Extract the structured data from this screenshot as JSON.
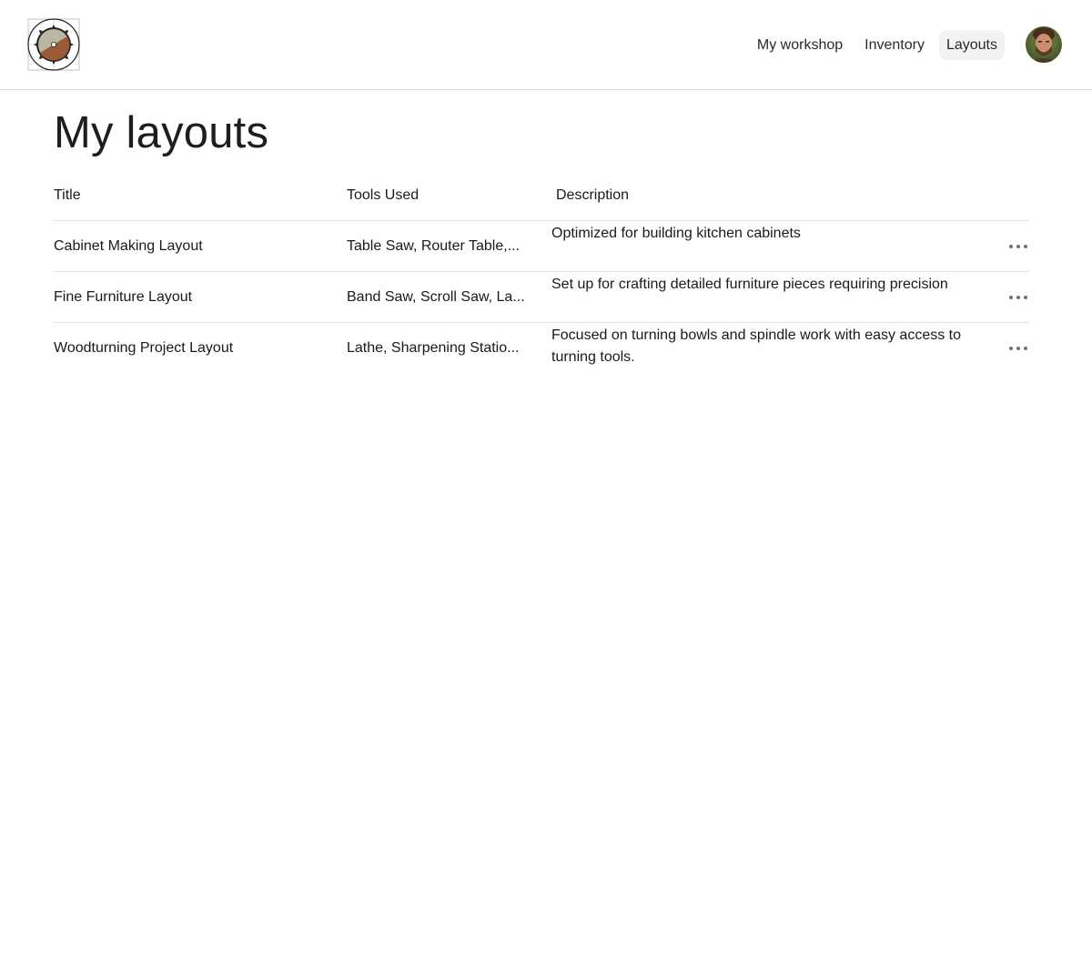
{
  "header": {
    "logo_icon": "circular-saw-blade-logo",
    "nav": [
      {
        "label": "My workshop",
        "active": false
      },
      {
        "label": "Inventory",
        "active": false
      },
      {
        "label": "Layouts",
        "active": true
      }
    ],
    "avatar_icon": "user-avatar"
  },
  "page": {
    "title": "My layouts"
  },
  "table": {
    "columns": [
      "Title",
      "Tools Used",
      "Description"
    ],
    "rows": [
      {
        "title": "Cabinet Making Layout",
        "tools": "Table Saw, Router Table,...",
        "description": "Optimized for building kitchen cabinets",
        "action_icon": "more-horizontal-icon"
      },
      {
        "title": "Fine Furniture Layout",
        "tools": "Band Saw, Scroll Saw, La...",
        "description": "Set up for crafting detailed furniture pieces requiring precision",
        "action_icon": "more-horizontal-icon"
      },
      {
        "title": "Woodturning Project Layout",
        "tools": "Lathe, Sharpening Statio...",
        "description": "Focused on turning bowls and spindle work with easy access to turning tools.",
        "action_icon": "more-horizontal-icon"
      }
    ]
  }
}
